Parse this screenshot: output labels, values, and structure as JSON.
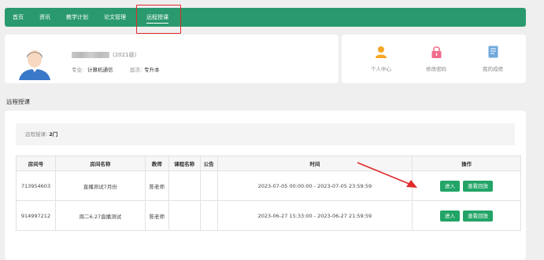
{
  "nav": {
    "items": [
      {
        "label": "首页"
      },
      {
        "label": "资讯"
      },
      {
        "label": "教学计划"
      },
      {
        "label": "论文管理"
      },
      {
        "label": "远程授课"
      }
    ]
  },
  "profile": {
    "grade": "(2021级)",
    "major_label": "专业:",
    "major": "计算机通信",
    "level_label": "层次:",
    "level": "专升本"
  },
  "quick_links": [
    {
      "label": "个人中心",
      "icon": "user-icon"
    },
    {
      "label": "修改密码",
      "icon": "lock-icon"
    },
    {
      "label": "我的成绩",
      "icon": "grade-icon"
    }
  ],
  "section": {
    "title": "远程授课"
  },
  "summary": {
    "label": "远程授课:",
    "count": "2门"
  },
  "table": {
    "headers": [
      "房间号",
      "房间名称",
      "教师",
      "课程名称",
      "公告",
      "时间",
      "操作"
    ],
    "rows": [
      {
        "room_id": "713954603",
        "room_name": "直播测试7月份",
        "teacher": "陈老师",
        "course": "",
        "notice": "",
        "time": "2023-07-05 00:00:00 - 2023-07-05 23:59:59",
        "enter": "进入",
        "replay": "查看回放"
      },
      {
        "room_id": "914997212",
        "room_name": "周二6.27直播测试",
        "teacher": "陈老师",
        "course": "",
        "notice": "",
        "time": "2023-06-27 15:33:00 - 2023-06-27 21:59:59",
        "enter": "进入",
        "replay": "查看回放"
      }
    ]
  },
  "colors": {
    "nav": "#2a9a6e",
    "button": "#22a466",
    "highlight": "#e02a2a",
    "user_icon": "#f5a623",
    "lock_icon": "#f06b8a",
    "grade_icon": "#6fa8dc"
  }
}
